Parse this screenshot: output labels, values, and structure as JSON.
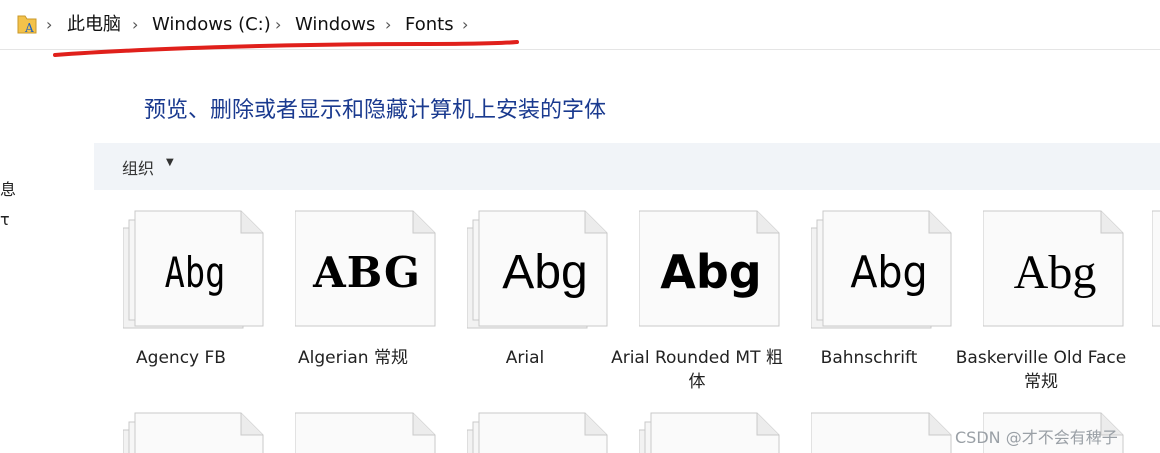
{
  "breadcrumb": {
    "items": [
      "此电脑",
      "Windows (C:)",
      "Windows",
      "Fonts"
    ]
  },
  "sidebar": {
    "items": [
      "息",
      "τ"
    ]
  },
  "page_title": "预览、删除或者显示和隐藏计算机上安装的字体",
  "toolbar": {
    "organize_label": "组织"
  },
  "fonts": [
    {
      "sample": "Abg",
      "label": "Agency FB",
      "stacked": true
    },
    {
      "sample": "ABG",
      "label": "Algerian 常规",
      "stacked": false
    },
    {
      "sample": "Abg",
      "label": "Arial",
      "stacked": true
    },
    {
      "sample": "Abg",
      "label": "Arial Rounded MT 粗体",
      "stacked": false
    },
    {
      "sample": "Abg",
      "label": "Bahnschrift",
      "stacked": true
    },
    {
      "sample": "Abg",
      "label": "Baskerville Old Face 常规",
      "stacked": false
    }
  ],
  "watermark": "CSDN @才不会有稗子",
  "colors": {
    "title": "#1a3a8f",
    "annotation": "#e0201b",
    "toolbar_bg": "#f1f4f8"
  }
}
